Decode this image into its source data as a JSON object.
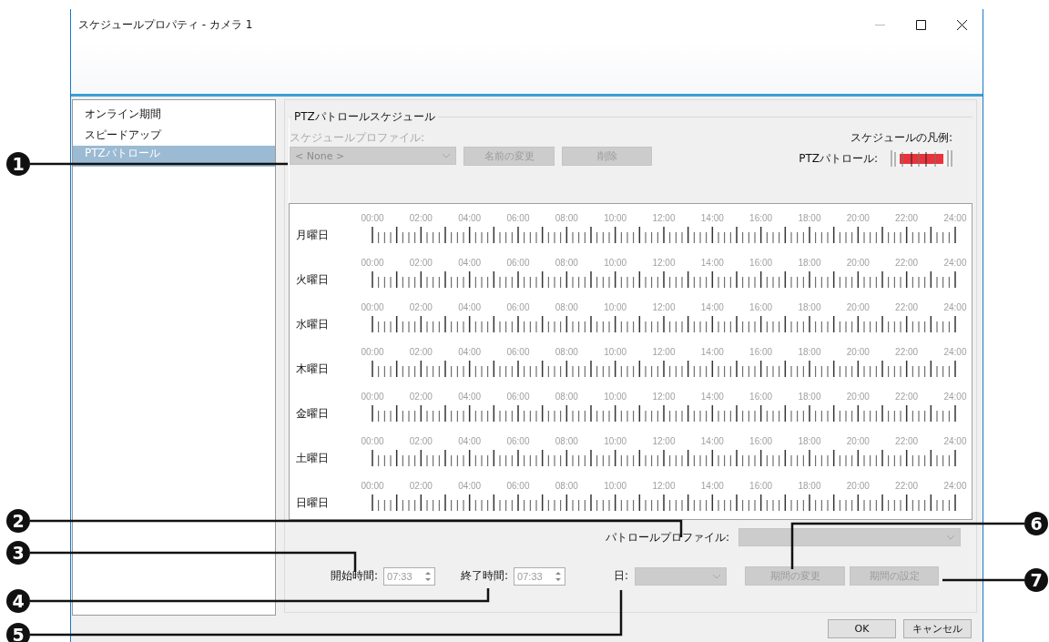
{
  "window": {
    "title": "スケジュールプロパティ - カメラ 1"
  },
  "sidebar": {
    "items": [
      {
        "label": "オンライン期間",
        "selected": false
      },
      {
        "label": "スピードアップ",
        "selected": false
      },
      {
        "label": "PTZパトロール",
        "selected": true
      }
    ]
  },
  "patrol_schedule": {
    "title": "PTZパトロールスケジュール",
    "profile_label": "スケジュールプロファイル:",
    "profile_dropdown": {
      "value": "< None >",
      "disabled": true
    },
    "rename_button": {
      "label": "名前の変更",
      "disabled": true
    },
    "delete_button": {
      "label": "削除",
      "disabled": true
    },
    "legend": {
      "title": "スケジュールの凡例:",
      "label": "PTZパトロール:"
    },
    "days": [
      {
        "label": "月曜日",
        "times": [
          "00:00",
          "02:00",
          "04:00",
          "06:00",
          "08:00",
          "10:00",
          "12:00",
          "14:00",
          "16:00",
          "18:00",
          "20:00",
          "22:00",
          "24:00"
        ]
      },
      {
        "label": "火曜日",
        "times": [
          "00:00",
          "02:00",
          "04:00",
          "06:00",
          "08:00",
          "10:00",
          "12:00",
          "14:00",
          "16:00",
          "18:00",
          "20:00",
          "22:00",
          "24:00"
        ]
      },
      {
        "label": "水曜日",
        "times": [
          "00:00",
          "02:00",
          "04:00",
          "06:00",
          "08:00",
          "10:00",
          "12:00",
          "14:00",
          "16:00",
          "18:00",
          "20:00",
          "22:00",
          "24:00"
        ]
      },
      {
        "label": "木曜日",
        "times": [
          "00:00",
          "02:00",
          "04:00",
          "06:00",
          "08:00",
          "10:00",
          "12:00",
          "14:00",
          "16:00",
          "18:00",
          "20:00",
          "22:00",
          "24:00"
        ]
      },
      {
        "label": "金曜日",
        "times": [
          "00:00",
          "02:00",
          "04:00",
          "06:00",
          "08:00",
          "10:00",
          "12:00",
          "14:00",
          "16:00",
          "18:00",
          "20:00",
          "22:00",
          "24:00"
        ]
      },
      {
        "label": "土曜日",
        "times": [
          "00:00",
          "02:00",
          "04:00",
          "06:00",
          "08:00",
          "10:00",
          "12:00",
          "14:00",
          "16:00",
          "18:00",
          "20:00",
          "22:00",
          "24:00"
        ]
      },
      {
        "label": "日曜日",
        "times": [
          "00:00",
          "02:00",
          "04:00",
          "06:00",
          "08:00",
          "10:00",
          "12:00",
          "14:00",
          "16:00",
          "18:00",
          "20:00",
          "22:00",
          "24:00"
        ]
      }
    ]
  },
  "patrol_profile": {
    "label": "パトロールプロファイル:",
    "disabled": true
  },
  "start_time": {
    "label": "開始時間:",
    "value": "07:33",
    "disabled": true
  },
  "end_time": {
    "label": "終了時間:",
    "value": "07:33",
    "disabled": true
  },
  "day": {
    "label": "日:",
    "disabled": true
  },
  "change_period_button": {
    "label": "期間の変更",
    "disabled": true
  },
  "set_period_button": {
    "label": "期間の設定",
    "disabled": true
  },
  "buttons": [
    {
      "label": "OK"
    },
    {
      "label": "キャンセル"
    }
  ],
  "callouts": [
    {
      "number": "1"
    },
    {
      "number": "2"
    },
    {
      "number": "3"
    },
    {
      "number": "4"
    },
    {
      "number": "5"
    },
    {
      "number": "6"
    },
    {
      "number": "7"
    }
  ]
}
